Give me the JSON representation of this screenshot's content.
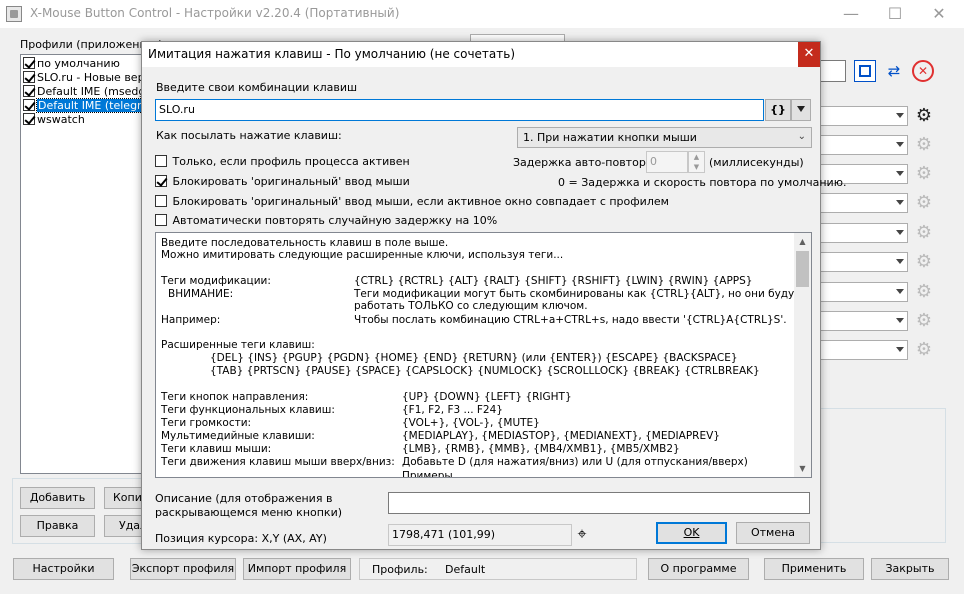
{
  "window": {
    "title": "X-Mouse Button Control - Настройки v2.20.4 (Портативный)",
    "minimize_glyph": "—",
    "maximize_glyph": "☐",
    "close_glyph": "✕"
  },
  "profiles": {
    "label": "Профили (приложения / ...",
    "items": [
      {
        "label": "по умолчанию",
        "checked": true
      },
      {
        "label": "SLO.ru - Новые верси",
        "checked": true
      },
      {
        "label": "Default IME (msedge)",
        "checked": true
      },
      {
        "label": "Default IME (telegram",
        "checked": true,
        "selected": true
      },
      {
        "label": "wswatch",
        "checked": true
      }
    ],
    "add_button": "Добавить",
    "copy_button": "Копир",
    "edit_button": "Правка",
    "delete_button": "Удал"
  },
  "bottom_bar": {
    "settings_button": "Настройки",
    "export_button": "Экспорт профиля",
    "import_button": "Импорт профиля",
    "profile_label": "Профиль:",
    "profile_value": "Default",
    "about_button": "О программе",
    "apply_button": "Применить",
    "close_button": "Закрыть"
  },
  "dialog": {
    "title": "Имитация нажатия клавиш - По умолчанию (не сочетать)",
    "close_glyph": "✕",
    "input_label": "Введите свои комбинации клавиш",
    "input_value": "SLO.ru",
    "braces_button": "{}",
    "send_label": "Как посылать нажатие клавиш:",
    "send_value": "1. При нажатии кнопки мыши",
    "only_if_active": {
      "label": "Только, если профиль процесса активен",
      "checked": false
    },
    "repeat_delay_label": "Задержка авто-повтора",
    "repeat_delay_value": "0",
    "repeat_delay_unit": "(миллисекунды)",
    "block_original": {
      "label": "Блокировать 'оригинальный' ввод мыши",
      "checked": true
    },
    "zero_note": "0 = Задержка и скорость повтора по умолчанию.",
    "block_if_window": {
      "label": "Блокировать 'оригинальный' ввод мыши, если активное окно совпадает с профилем",
      "checked": false
    },
    "auto_repeat": {
      "label": "Автоматически повторять случайную задержку на 10%",
      "checked": false
    },
    "help": {
      "intro1": "Введите последовательность клавиш в поле выше.",
      "intro2": "Можно имитировать следующие расширенные ключи, используя теги...",
      "mod_label": "Теги модификации:",
      "mod_value": "{CTRL} {RCTRL} {ALT} {RALT} {SHIFT} {RSHIFT} {LWIN} {RWIN} {APPS}",
      "warn_label": "ВНИМАНИЕ:",
      "warn_value1": "Теги модификации могут быть скомбинированы как {CTRL}{ALT}, но они будут",
      "warn_value2": "работать ТОЛЬКО со следующим ключом.",
      "example_label": "Например:",
      "example_value": "Чтобы послать комбинацию CTRL+a+CTRL+s, надо ввести '{CTRL}A{CTRL}S'.",
      "ext_label": "Расширенные теги клавиш:",
      "ext_line1": "{DEL} {INS} {PGUP} {PGDN} {HOME} {END} {RETURN} (или {ENTER}) {ESCAPE} {BACKSPACE}",
      "ext_line2": "{TAB} {PRTSCN} {PAUSE} {SPACE} {CAPSLOCK} {NUMLOCK} {SCROLLLOCK} {BREAK} {CTRLBREAK}",
      "dir_label": "Теги кнопок направления:",
      "dir_value": "{UP} {DOWN} {LEFT} {RIGHT}",
      "fn_label": "Теги функциональных клавиш:",
      "fn_value": "{F1, F2, F3 ... F24}",
      "vol_label": "Теги громкости:",
      "vol_value": "{VOL+}, {VOL-}, {MUTE}",
      "media_label": "Мультимедийные клавиши:",
      "media_value": "{MEDIAPLAY}, {MEDIASTOP}, {MEDIANEXT}, {MEDIAPREV}",
      "mouse_label": "Теги клавиш мыши:",
      "mouse_value": "{LMB}, {RMB}, {MMB}, {MB4/XMB1}, {MB5/XMB2}",
      "move_label": "Теги движения клавиш мыши вверх/вниз:",
      "move_value": "Добавьте D (для нажатия/вниз) или U (для отпускания/вверх)",
      "cut_value": "Примеры"
    },
    "desc_label1": "Описание (для отображения в",
    "desc_label2": "раскрывающемся меню кнопки)",
    "desc_value": "",
    "cursor_label": "Позиция курсора: X,Y (AX, AY)",
    "cursor_value": "1798,471 (101,99)",
    "ok_button": "OK",
    "cancel_button": "Отмена"
  }
}
